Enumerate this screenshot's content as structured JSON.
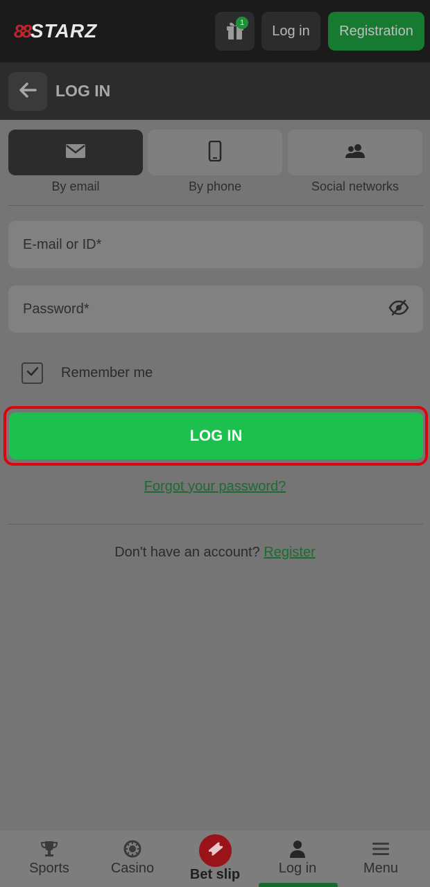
{
  "header": {
    "logo_mark": "88",
    "logo_text": "STARZ",
    "gift_badge_count": "1",
    "login_label": "Log in",
    "registration_label": "Registration"
  },
  "page": {
    "title": "LOG IN"
  },
  "login_methods": [
    {
      "label": "By email",
      "icon": "envelope-icon",
      "active": true
    },
    {
      "label": "By phone",
      "icon": "phone-icon",
      "active": false
    },
    {
      "label": "Social networks",
      "icon": "people-icon",
      "active": false
    }
  ],
  "form": {
    "email_placeholder": "E-mail or ID*",
    "email_value": "",
    "password_placeholder": "Password*",
    "password_value": "",
    "remember_label": "Remember me",
    "remember_checked": true,
    "submit_label": "LOG IN",
    "forgot_label": "Forgot your password?",
    "no_account_text": "Don't have an account?",
    "register_link": "Register"
  },
  "bottom_nav": [
    {
      "label": "Sports",
      "icon": "trophy-icon"
    },
    {
      "label": "Casino",
      "icon": "casino-chip-icon"
    },
    {
      "label": "Bet slip",
      "icon": "ticket-icon"
    },
    {
      "label": "Log in",
      "icon": "user-icon",
      "active": true
    },
    {
      "label": "Menu",
      "icon": "hamburger-icon"
    }
  ],
  "colors": {
    "brand_green": "#1dc04e",
    "brand_red": "#c0242a",
    "highlight_outline": "#d8070f"
  }
}
